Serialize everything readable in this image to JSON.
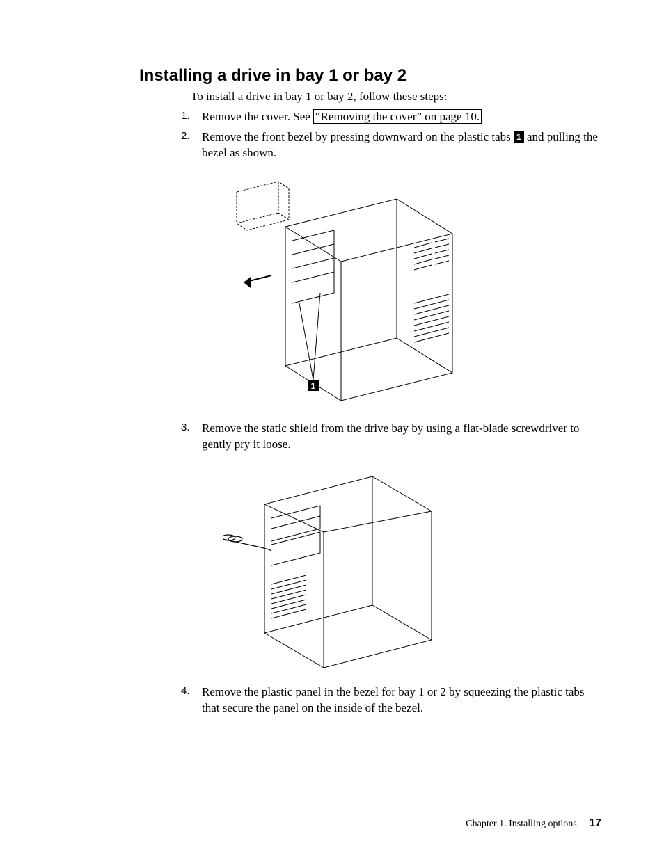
{
  "heading": "Installing a drive in bay 1 or bay 2",
  "intro": "To install a drive in bay 1 or bay 2, follow these steps:",
  "steps": {
    "s1": {
      "num": "1.",
      "pre": "Remove the cover. See ",
      "xref": "“Removing the cover” on page 10."
    },
    "s2": {
      "num": "2.",
      "pre": "Remove the front bezel by pressing downward on the plastic tabs ",
      "callout": "1",
      "post": " and pulling the bezel as shown."
    },
    "s3": {
      "num": "3.",
      "text": "Remove the static shield from the drive bay by using a flat-blade screwdriver to gently pry it loose."
    },
    "s4": {
      "num": "4.",
      "text": "Remove the plastic panel in the bezel for bay 1 or 2 by squeezing the plastic tabs that secure the panel on the inside of the bezel."
    }
  },
  "fig1_callout": "1",
  "footer": {
    "chapter": "Chapter 1. Installing options",
    "page": "17"
  }
}
